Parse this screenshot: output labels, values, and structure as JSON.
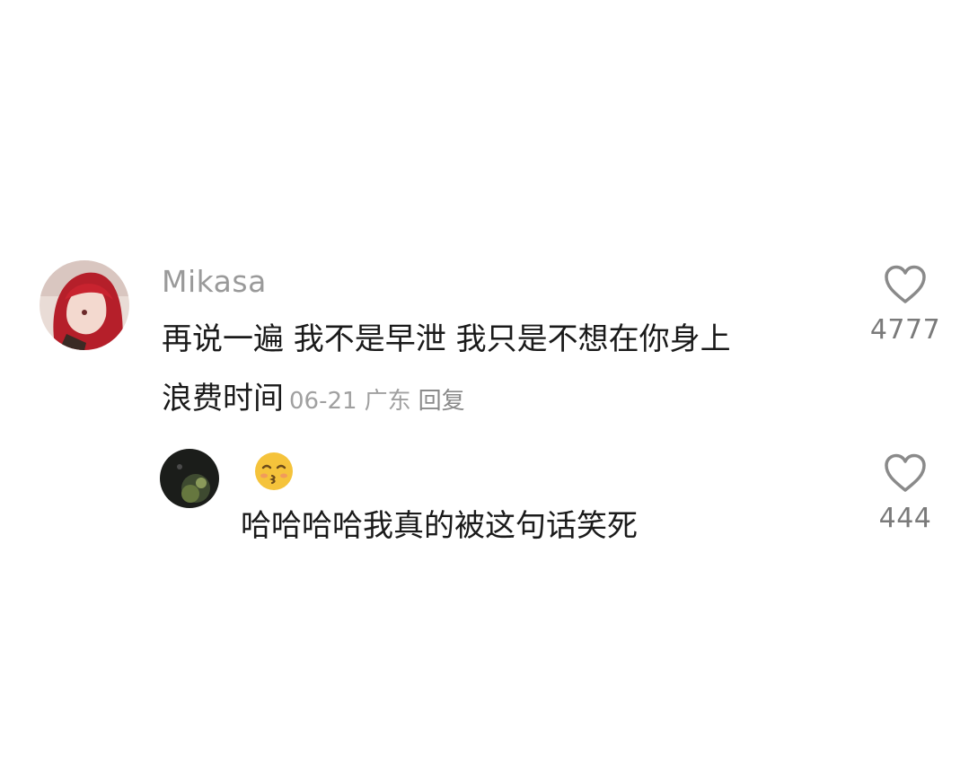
{
  "comments": [
    {
      "username": "Mikasa",
      "text_line1": "再说一遍 我不是早泄 我只是不想在你身上",
      "text_line2": "浪费时间",
      "date": "06-21",
      "location": "广东",
      "reply_label": "回复",
      "likes": "4777",
      "avatar_icon": "red-haired-anime-avatar",
      "like_icon": "heart-outline-icon"
    },
    {
      "username_emoji": "😚",
      "text": "哈哈哈哈我真的被这句话笑死",
      "likes": "444",
      "avatar_icon": "dark-nature-avatar",
      "like_icon": "heart-outline-icon"
    }
  ],
  "colors": {
    "username": "#9a9a9a",
    "body": "#1a1a1a",
    "meta": "#a0a0a0",
    "like_count": "#7a7a7a",
    "heart_stroke": "#8a8a8a"
  }
}
